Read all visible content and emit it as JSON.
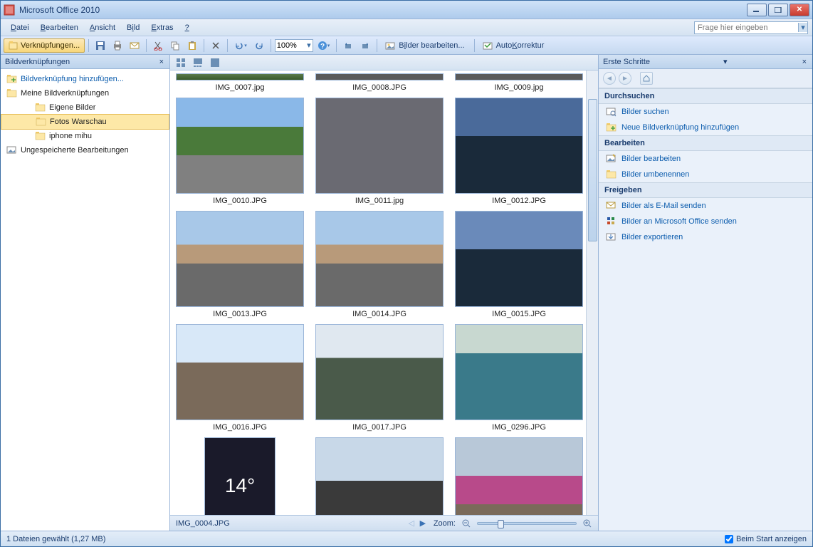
{
  "window": {
    "title": "Microsoft Office 2010"
  },
  "menu": {
    "items": [
      "Datei",
      "Bearbeiten",
      "Ansicht",
      "Bild",
      "Extras",
      "?"
    ],
    "help_placeholder": "Frage hier eingeben"
  },
  "toolbar": {
    "shortcuts_btn": "Verknüpfungen...",
    "zoom_value": "100%",
    "edit_pics": "Bilder bearbeiten...",
    "autocorrect": "AutoKorrektur"
  },
  "left_pane": {
    "title": "Bildverknüpfungen",
    "add_link": "Bildverknüpfung hinzufügen...",
    "root": "Meine Bildverknüpfungen",
    "items": [
      "Eigene Bilder",
      "Fotos Warschau",
      "iphone mihu"
    ],
    "unsaved": "Ungespeicherte Bearbeitungen"
  },
  "thumbs": {
    "row_top": [
      "IMG_0007.jpg",
      "IMG_0008.JPG",
      "IMG_0009.jpg"
    ],
    "row1": [
      "IMG_0010.JPG",
      "IMG_0011.jpg",
      "IMG_0012.JPG"
    ],
    "row2": [
      "IMG_0013.JPG",
      "IMG_0014.JPG",
      "IMG_0015.JPG"
    ],
    "row3": [
      "IMG_0016.JPG",
      "IMG_0017.JPG",
      "IMG_0296.JPG"
    ],
    "row4": [
      "",
      "",
      ""
    ]
  },
  "center_footer": {
    "current": "IMG_0004.JPG",
    "zoom_label": "Zoom:"
  },
  "right_pane": {
    "title": "Erste Schritte",
    "sections": {
      "browse": {
        "head": "Durchsuchen",
        "items": [
          "Bilder suchen",
          "Neue Bildverknüpfung hinzufügen"
        ]
      },
      "edit": {
        "head": "Bearbeiten",
        "items": [
          "Bilder bearbeiten",
          "Bilder umbenennen"
        ]
      },
      "share": {
        "head": "Freigeben",
        "items": [
          "Bilder als E-Mail senden",
          "Bilder an Microsoft Office senden",
          "Bilder exportieren"
        ]
      }
    }
  },
  "status": {
    "text": "1 Dateien gewählt (1,27 MB)",
    "show_at_start": "Beim Start anzeigen"
  }
}
